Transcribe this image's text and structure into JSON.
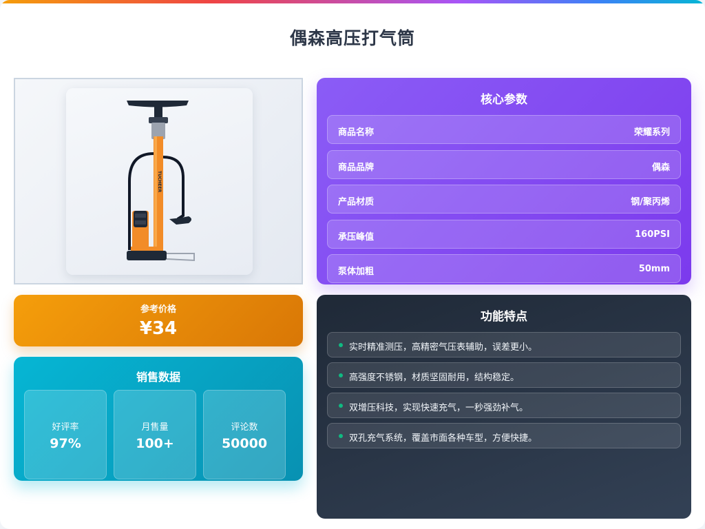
{
  "page": {
    "title": "偶森高压打气筒"
  },
  "product_image": {
    "alt": "floor pump",
    "brand_mark": "TUCHEER"
  },
  "price": {
    "label": "参考价格",
    "value": "¥34"
  },
  "sales": {
    "title": "销售数据",
    "stats": [
      {
        "label": "好评率",
        "value": "97%"
      },
      {
        "label": "月售量",
        "value": "100+"
      },
      {
        "label": "评论数",
        "value": "50000"
      }
    ]
  },
  "params": {
    "title": "核心参数",
    "rows": [
      {
        "key": "商品名称",
        "value": "荣耀系列"
      },
      {
        "key": "商品品牌",
        "value": "偶森"
      },
      {
        "key": "产品材质",
        "value": "钢/聚丙烯"
      },
      {
        "key": "承压峰值",
        "value": "160PSI"
      },
      {
        "key": "泵体加粗",
        "value": "50mm"
      }
    ]
  },
  "features": {
    "title": "功能特点",
    "items": [
      "实时精准测压，高精密气压表辅助，误差更小。",
      "高强度不锈钢，材质坚固耐用，结构稳定。",
      "双增压科技，实现快速充气，一秒强劲补气。",
      "双孔充气系统，覆盖市面各种车型，方便快捷。"
    ]
  },
  "colors": {
    "price_accent": "#f59e0b",
    "sales_accent": "#06b6d4",
    "params_accent": "#8b5cf6",
    "features_bg": "#1f2937",
    "feature_bullet": "#10b981"
  }
}
